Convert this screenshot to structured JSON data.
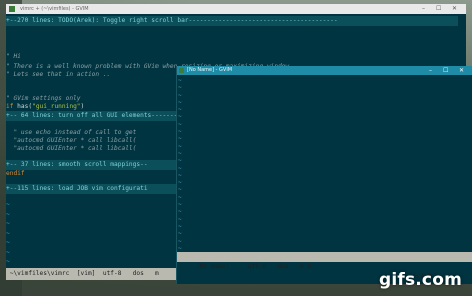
{
  "window_main": {
    "title": "vimrc + (~\\vimfiles) - GVIM",
    "controls": [
      "–",
      "☐",
      "✕"
    ],
    "lines": [
      {
        "kind": "fold",
        "text": "+--270 lines: TODO(Arek): Toggle right scroll bar----------------------------------------"
      },
      {
        "kind": "blank",
        "text": ""
      },
      {
        "kind": "blank",
        "text": ""
      },
      {
        "kind": "comment",
        "text": "\" Hi"
      },
      {
        "kind": "comment",
        "text": "\" There is a well known problem with GVim when resizing or maximizing window"
      },
      {
        "kind": "comment",
        "text": "\" Lets see that in action .."
      },
      {
        "kind": "blank",
        "text": ""
      },
      {
        "kind": "comment",
        "text": "\" GVim settings only"
      },
      {
        "kind": "if",
        "text_kw": "if",
        "text_rest": " has(",
        "text_str": "\"gui_running\"",
        "text_end": ")"
      },
      {
        "kind": "fold",
        "text": "+-- 64 lines: turn off all GUI elements-------------------"
      },
      {
        "kind": "blank",
        "text": ""
      },
      {
        "kind": "comment",
        "text": "  \" use echo instead of call to get"
      },
      {
        "kind": "comment",
        "text": "  \"autocmd GUIEnter * call libcall("
      },
      {
        "kind": "comment",
        "text": "  \"autocmd GUIEnter * call libcall("
      },
      {
        "kind": "blank",
        "text": ""
      },
      {
        "kind": "fold",
        "text": "+-- 37 lines: smooth scroll mappings--"
      },
      {
        "kind": "endif",
        "text": "endif"
      },
      {
        "kind": "blank",
        "text": ""
      },
      {
        "kind": "fold",
        "text": "+--115 lines: load JOB vim configurati"
      }
    ],
    "tilde_count": 7,
    "statusline": " ~\\vimfiles\\vimrc  [vim]  utf-8   dos   m "
  },
  "window_front": {
    "title": "[No Name] - GVIM",
    "controls": [
      "–",
      "☐",
      "✕"
    ],
    "tilde_count": 24,
    "statusline": " [No Name]     utf-8   dos   m H",
    "position": "0/1 0"
  },
  "watermark": "gifs.com",
  "colors": {
    "editor_bg": "#003440",
    "fold_bg": "#0b4f5b",
    "statusline_bg": "#b9b9b0",
    "front_titlebar": "#1e8ca7"
  }
}
